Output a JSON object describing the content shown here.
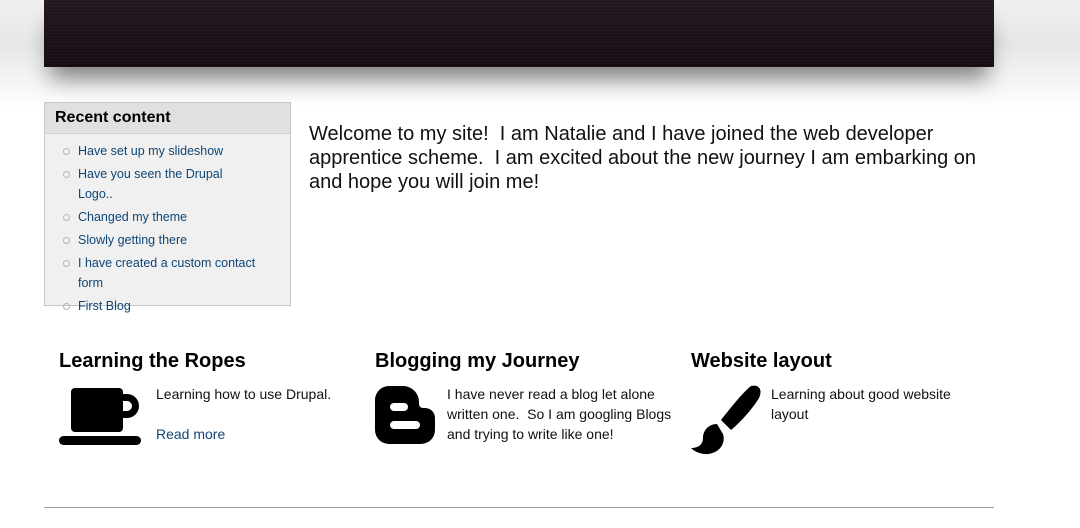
{
  "sidebar": {
    "title": "Recent content",
    "items": [
      {
        "label": "Have set up my slideshow"
      },
      {
        "label": "Have you seen the Drupal Logo.."
      },
      {
        "label": "Changed my theme"
      },
      {
        "label": "Slowly getting there"
      },
      {
        "label": "I have created a custom contact form"
      },
      {
        "label": "First Blog"
      }
    ]
  },
  "main": {
    "welcome": "Welcome to my site!  I am Natalie and I have joined the web developer apprentice scheme.  I am excited about the new journey I am embarking on and hope you will join me!"
  },
  "features": [
    {
      "title": "Learning the Ropes",
      "icon": "coffee-cup-icon",
      "text": "Learning how to use Drupal.",
      "link": "Read more"
    },
    {
      "title": "Blogging my Journey",
      "icon": "blogger-icon",
      "text": "I have never read a blog let alone written one.  So I am googling Blogs and trying to write like one!"
    },
    {
      "title": "Website layout",
      "icon": "paintbrush-icon",
      "text": "Learning about good website layout"
    }
  ],
  "colors": {
    "banner": "#1c1119",
    "link": "#0f4575",
    "sidebar_bg": "#f0f0f0",
    "sidebar_title_bg": "#e0e0e0"
  }
}
